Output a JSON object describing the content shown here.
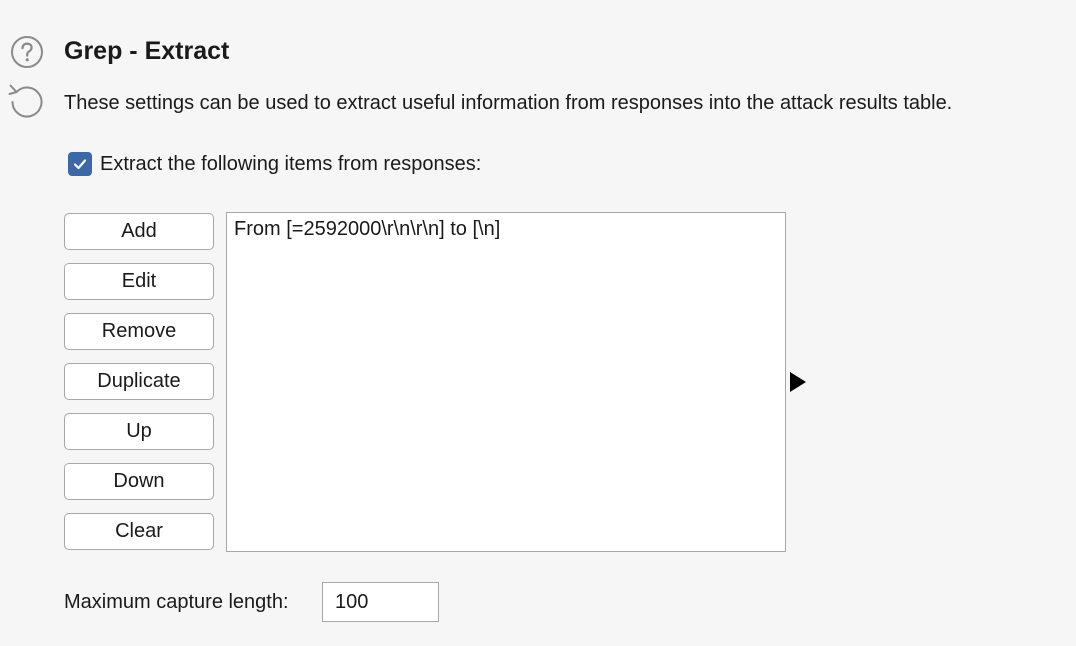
{
  "section": {
    "title": "Grep - Extract",
    "description": "These settings can be used to extract useful information from responses into the attack results table.",
    "help_icon": "question-circle-icon",
    "reset_icon": "reset-arrow-icon"
  },
  "extract": {
    "checkbox_label": "Extract the following items from responses:",
    "checked": true,
    "items": [
      "From [=2592000\\r\\n\\r\\n] to [\\n]"
    ]
  },
  "buttons": {
    "add": "Add",
    "edit": "Edit",
    "remove": "Remove",
    "duplicate": "Duplicate",
    "up": "Up",
    "down": "Down",
    "clear": "Clear"
  },
  "capture": {
    "label": "Maximum capture length:",
    "value": "100"
  },
  "colors": {
    "checkbox_accent": "#3c67a8",
    "background": "#f6f6f6",
    "icon_gray": "#8a8a8a"
  }
}
